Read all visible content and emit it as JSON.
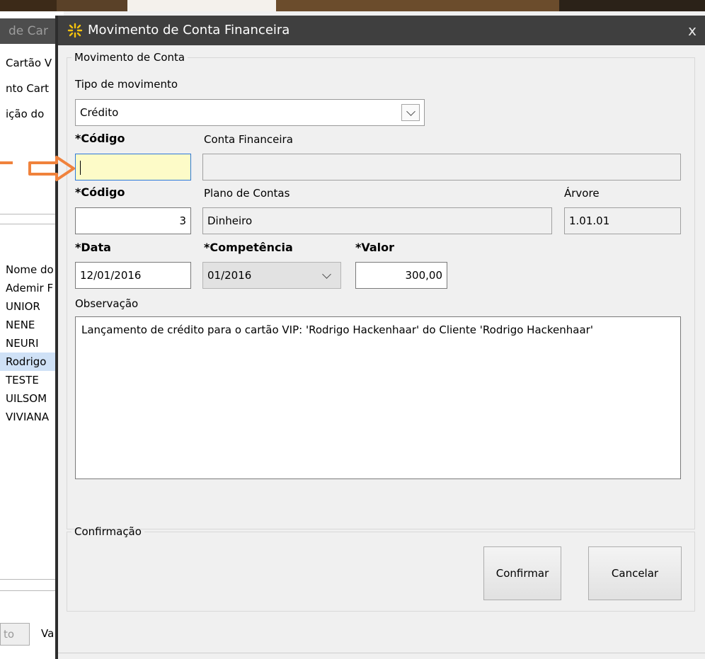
{
  "background_window": {
    "title_fragment": "de Car",
    "lines": [
      "Cartão V",
      "nto Cart",
      "ição do "
    ],
    "list_header": "Nome do",
    "list_items": [
      "Ademir F",
      "UNIOR",
      "NENE",
      "NEURI",
      "Rodrigo ",
      "TESTE",
      "UILSOM",
      "VIVIANA"
    ],
    "bottom_button": "to",
    "bottom_label": "Va"
  },
  "dialog": {
    "title": "Movimento de Conta Financeira",
    "close_glyph": "x",
    "group_movimento": {
      "legend": "Movimento de Conta",
      "tipo_movimento": {
        "label": "Tipo de movimento",
        "value": "Crédito"
      },
      "conta_financeira": {
        "codigo_label": "*Código",
        "codigo_value": "",
        "descricao_label": "Conta Financeira",
        "descricao_value": ""
      },
      "plano_contas": {
        "codigo_label": "*Código",
        "codigo_value": "3",
        "descricao_label": "Plano de Contas",
        "descricao_value": "Dinheiro",
        "arvore_label": "Árvore",
        "arvore_value": "1.01.01"
      },
      "data": {
        "label": "*Data",
        "value": "12/01/2016"
      },
      "competencia": {
        "label": "*Competência",
        "value": "01/2016"
      },
      "valor": {
        "label": "*Valor",
        "value": "300,00"
      },
      "observacao": {
        "label": "Observação",
        "value": "Lançamento de crédito para o cartão VIP: 'Rodrigo Hackenhaar' do Cliente 'Rodrigo Hackenhaar'"
      }
    },
    "group_confirmacao": {
      "legend": "Confirmação",
      "confirm_label": "Confirmar",
      "cancel_label": "Cancelar"
    }
  },
  "colors": {
    "titlebar": "#3f3f3f",
    "active_input": "#fdfbc8",
    "annotation_arrow": "#f0823c",
    "selected_row": "#cfe1f6"
  },
  "icons": {
    "app": "yellow-sparkle-icon",
    "close": "close-icon",
    "combo": "chevron-down-icon",
    "annotation": "orange-arrow-icon"
  }
}
